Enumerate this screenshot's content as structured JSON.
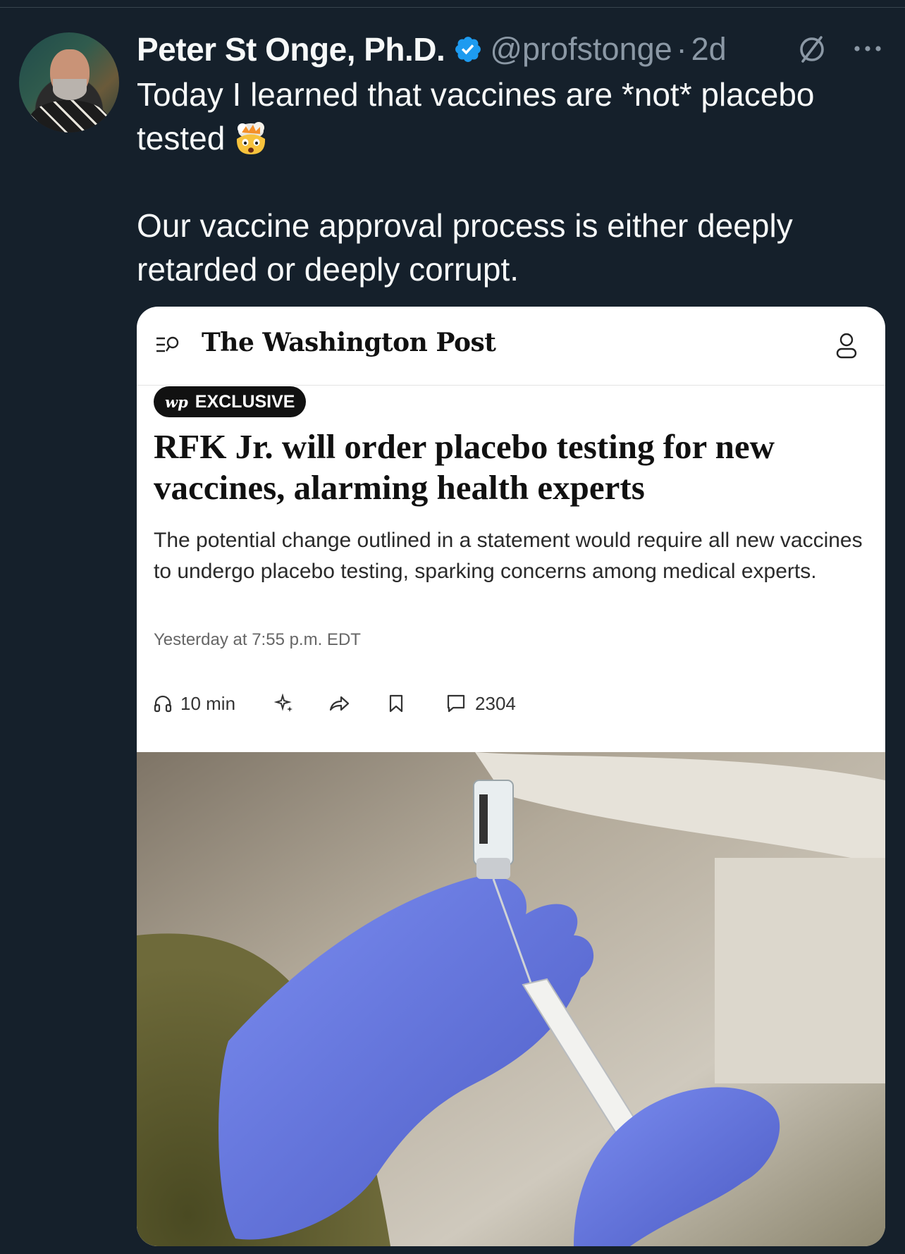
{
  "tweet": {
    "display_name": "Peter St Onge, Ph.D.",
    "handle": "@profstonge",
    "separator": "·",
    "time": "2d",
    "text_line1": "Today I learned that vaccines are *not* placebo tested",
    "text_line2": "Our vaccine approval process is either deeply retarded or deeply corrupt.",
    "emoji": "exploding-head-emoji"
  },
  "article": {
    "publication": "The Washington Post",
    "badge_mono": "wp",
    "badge_label": "EXCLUSIVE",
    "headline": "RFK Jr. will order placebo testing for new vaccines, alarming health experts",
    "subheadline": "The potential change outlined in a statement would require all new vaccines to undergo placebo testing, sparking concerns among medical experts.",
    "dateline": "Yesterday at 7:55 p.m. EDT",
    "listen_time": "10 min",
    "comment_count": "2304"
  },
  "colors": {
    "background": "#15202b",
    "verified_blue": "#1d9bf0",
    "secondary_text": "#8b98a5",
    "glove_blue": "#6d7fe0"
  }
}
